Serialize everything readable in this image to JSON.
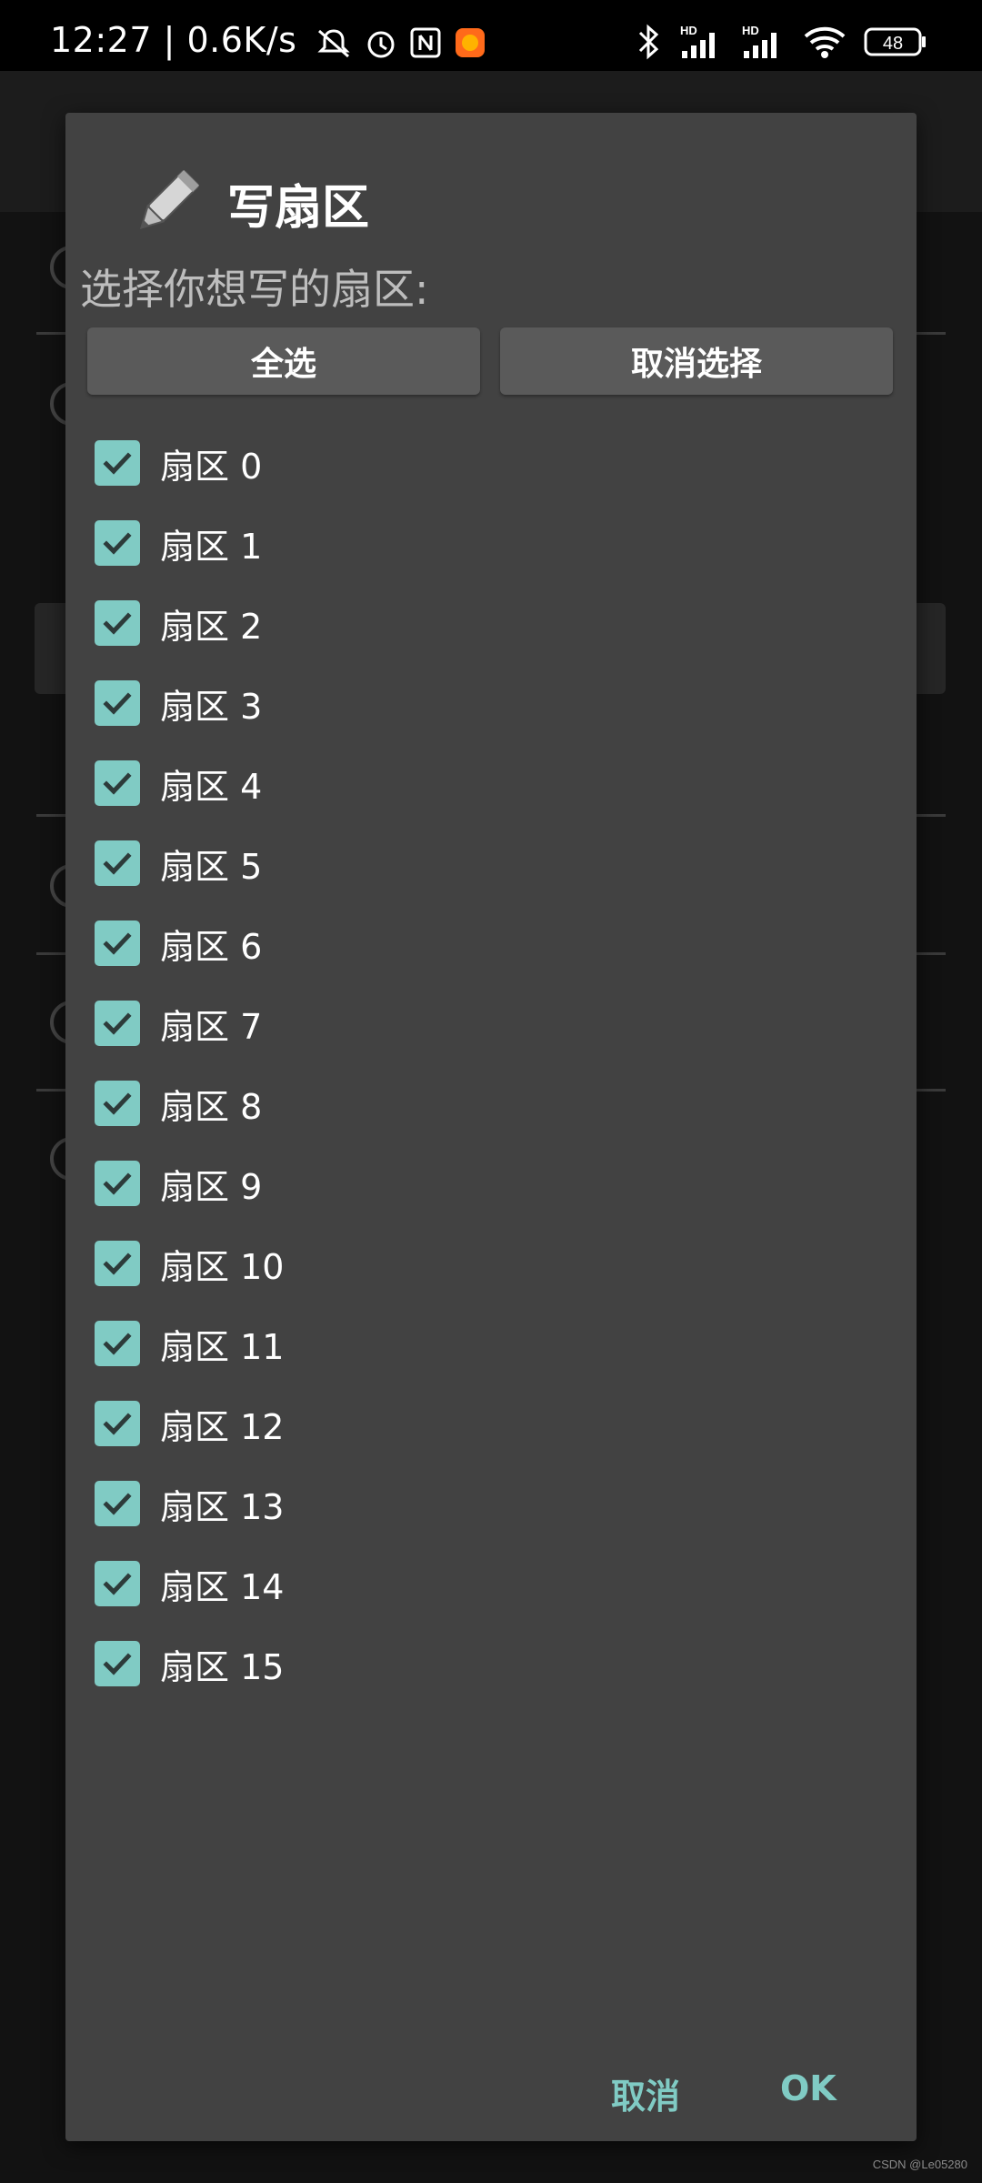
{
  "status_bar": {
    "time": "12:27",
    "network_speed": "0.6K/s",
    "battery": "48",
    "icons": [
      "mute-icon",
      "alarm-icon",
      "nfc-icon",
      "app-icon",
      "bluetooth-icon",
      "signal-hd-icon",
      "signal-hd-icon",
      "wifi-icon",
      "battery-icon"
    ]
  },
  "dialog": {
    "title": "写扇区",
    "title_icon": "pencil-icon",
    "subtitle": "选择你想写的扇区:",
    "select_all_label": "全选",
    "deselect_label": "取消选择",
    "sectors": [
      {
        "label": "扇区 0",
        "checked": true
      },
      {
        "label": "扇区 1",
        "checked": true
      },
      {
        "label": "扇区 2",
        "checked": true
      },
      {
        "label": "扇区 3",
        "checked": true
      },
      {
        "label": "扇区 4",
        "checked": true
      },
      {
        "label": "扇区 5",
        "checked": true
      },
      {
        "label": "扇区 6",
        "checked": true
      },
      {
        "label": "扇区 7",
        "checked": true
      },
      {
        "label": "扇区 8",
        "checked": true
      },
      {
        "label": "扇区 9",
        "checked": true
      },
      {
        "label": "扇区 10",
        "checked": true
      },
      {
        "label": "扇区 11",
        "checked": true
      },
      {
        "label": "扇区 12",
        "checked": true
      },
      {
        "label": "扇区 13",
        "checked": true
      },
      {
        "label": "扇区 14",
        "checked": true
      },
      {
        "label": "扇区 15",
        "checked": true
      }
    ],
    "cancel_label": "取消",
    "ok_label": "OK"
  },
  "colors": {
    "accent": "#80cbc4",
    "dialog_bg": "#424242",
    "button_bg": "#5a5a5a"
  },
  "watermark": "CSDN @Le05280"
}
